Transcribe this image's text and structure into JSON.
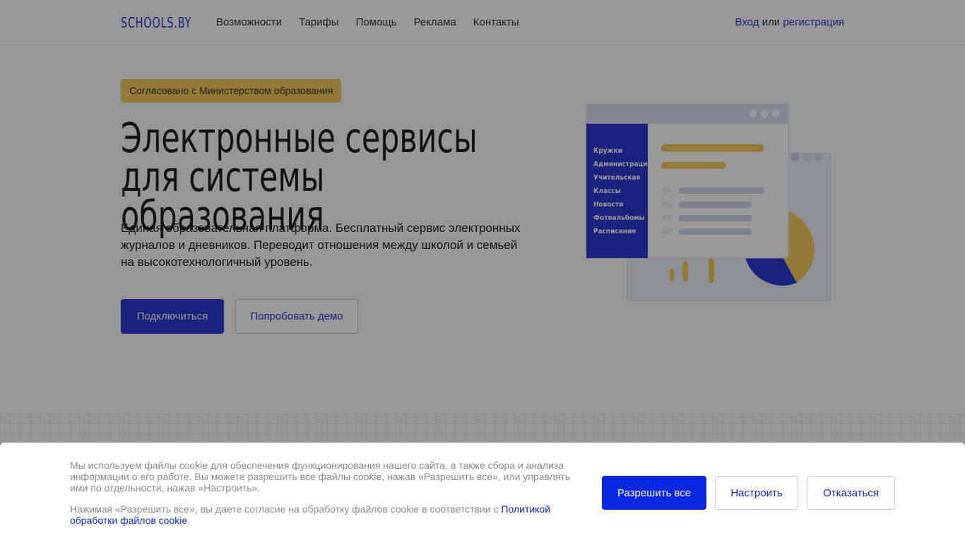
{
  "header": {
    "logo": "SCHOOLS.BY",
    "nav": [
      "Возможности",
      "Тарифы",
      "Помощь",
      "Реклама",
      "Контакты"
    ],
    "login": "Вход",
    "or": " или ",
    "register": "регистрация"
  },
  "hero": {
    "badge": "Согласовано с Министерством образования",
    "title_line1": "Электронные сервисы",
    "title_line2": "для системы образования",
    "lead": "Единая образовательная платформа. Бесплатный сервис электронных журналов и дневников. Переводит отношения между школой и семьей на высокотехнологичный уровень.",
    "connect": "Подключиться",
    "demo": "Попробовать демо"
  },
  "illustration": {
    "menu": [
      "Кружки",
      "Администрация",
      "Учительская",
      "Классы",
      "Новости",
      "Фотоальбомы",
      "Расписание"
    ],
    "colors": {
      "blue": "#2a3bd1",
      "yellow": "#f5cc5c"
    }
  },
  "cookie": {
    "text1": "Мы используем файлы cookie для обеспечения функционирования нашего сайта, а также сбора и анализа информации о его работе. Вы можете разрешить все файлы cookie, нажав «Разрешить все», или управлять ими по отдельности, нажав «Настроить».",
    "text2": "Нажимая «Разрешить все», вы даете согласие на обработку файлов cookie в соответствии с ",
    "link": "Политикой обработки файлов cookie",
    "end": ".",
    "allow": "Разрешить все",
    "configure": "Настроить",
    "decline": "Отказаться"
  }
}
